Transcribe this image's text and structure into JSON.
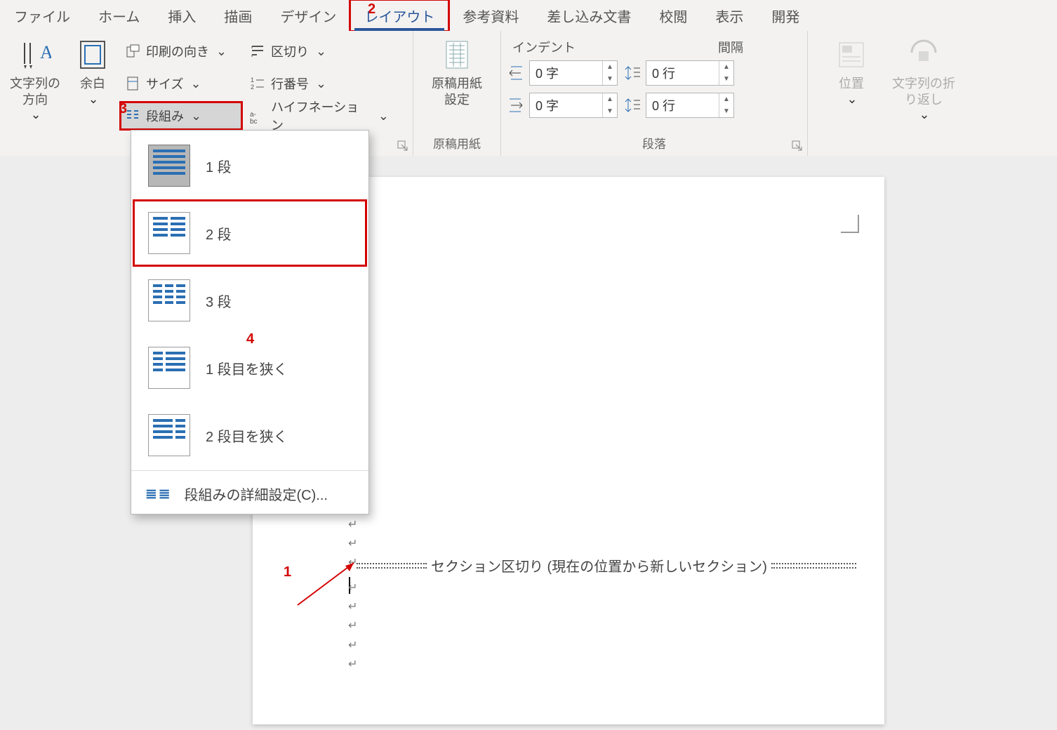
{
  "tabs": {
    "file": "ファイル",
    "home": "ホーム",
    "insert": "挿入",
    "draw": "描画",
    "design": "デザイン",
    "layout": "レイアウト",
    "references": "参考資料",
    "mailings": "差し込み文書",
    "review": "校閲",
    "view": "表示",
    "developer": "開発"
  },
  "ribbon": {
    "text_direction": "文字列の\n方向",
    "margins": "余白",
    "orientation": "印刷の向き",
    "size": "サイズ",
    "columns": "段組み",
    "breaks": "区切り",
    "line_numbers": "行番号",
    "hyphenation": "ハイフネーション",
    "manuscript_paper": "原稿用紙\n設定",
    "group_manuscript": "原稿用紙",
    "indent_title": "インデント",
    "spacing_title": "間隔",
    "indent_left": "0 字",
    "indent_right": "0 字",
    "spacing_before": "0 行",
    "spacing_after": "0 行",
    "group_paragraph": "段落",
    "position": "位置",
    "text_wrap": "文字列の折\nり返し"
  },
  "columns_menu": {
    "one": "1 段",
    "two": "2 段",
    "three": "3 段",
    "left_narrow": "1 段目を狭く",
    "right_narrow": "2 段目を狭く",
    "more": "段組みの詳細設定(C)..."
  },
  "doc": {
    "section_break": "セクション区切り (現在の位置から新しいセクション)"
  },
  "annotations": {
    "1": "1",
    "2": "2",
    "3": "3",
    "4": "4"
  }
}
